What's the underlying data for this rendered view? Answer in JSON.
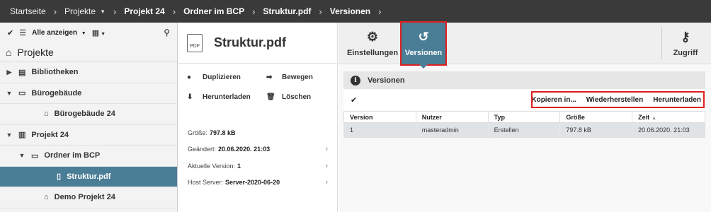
{
  "breadcrumb": [
    {
      "label": "Startseite",
      "bold": false,
      "caret": false
    },
    {
      "label": "Projekte",
      "bold": false,
      "caret": true
    },
    {
      "label": "Projekt 24",
      "bold": true,
      "caret": false
    },
    {
      "label": "Ordner im BCP",
      "bold": true,
      "caret": false
    },
    {
      "label": "Struktur.pdf",
      "bold": true,
      "caret": false
    },
    {
      "label": "Versionen",
      "bold": true,
      "caret": false
    }
  ],
  "left_toolbar": {
    "filter_label": "Alle anzeigen"
  },
  "tree": {
    "root_label": "Projekte",
    "nodes": [
      {
        "label": "Bibliotheken",
        "toggle": "right",
        "icon": "library-icon",
        "indent": 0,
        "selected": false
      },
      {
        "label": "Bürogebäude",
        "toggle": "down",
        "icon": "folder-icon",
        "indent": 0,
        "selected": false
      },
      {
        "label": "Bürogebäude 24",
        "toggle": "",
        "icon": "house-icon",
        "indent": 2,
        "selected": false
      },
      {
        "label": "Projekt 24",
        "toggle": "down",
        "icon": "building-icon",
        "indent": 0,
        "selected": false
      },
      {
        "label": "Ordner im BCP",
        "toggle": "down",
        "icon": "folder-icon",
        "indent": 1,
        "selected": false
      },
      {
        "label": "Struktur.pdf",
        "toggle": "",
        "icon": "file-icon",
        "indent": 3,
        "selected": true
      },
      {
        "label": "Demo Projekt 24",
        "toggle": "",
        "icon": "house-icon",
        "indent": 2,
        "selected": false
      }
    ]
  },
  "file": {
    "title": "Struktur.pdf",
    "icon_text": "PDF"
  },
  "actions": {
    "duplicate": "Duplizieren",
    "move": "Bewegen",
    "download": "Herunterladen",
    "delete": "Löschen"
  },
  "properties": [
    {
      "label": "Größe:",
      "value": "797.8 kB",
      "chevron": false
    },
    {
      "label": "Geändert:",
      "value": "20.06.2020. 21:03",
      "chevron": true
    },
    {
      "label": "Aktuelle Version:",
      "value": "1",
      "chevron": true
    },
    {
      "label": "Host Server:",
      "value": "Server-2020-06-20",
      "chevron": true
    }
  ],
  "toolbar": {
    "settings_label": "Einstellungen",
    "versions_label": "Versionen",
    "access_label": "Zugriff"
  },
  "versions_panel": {
    "title": "Versionen",
    "buttons": [
      "Kopieren in...",
      "Wiederherstellen",
      "Herunterladen"
    ],
    "columns": [
      "Version",
      "Nutzer",
      "Typ",
      "Größe",
      "Zeit"
    ],
    "sort_column": "Zeit",
    "rows": [
      [
        "1",
        "masteradmin",
        "Erstellen",
        "797.8 kB",
        "20.06.2020. 21:03"
      ]
    ]
  },
  "colors": {
    "accent": "#4a7d96",
    "topbar": "#3a3a3a",
    "highlight": "#e02020"
  }
}
